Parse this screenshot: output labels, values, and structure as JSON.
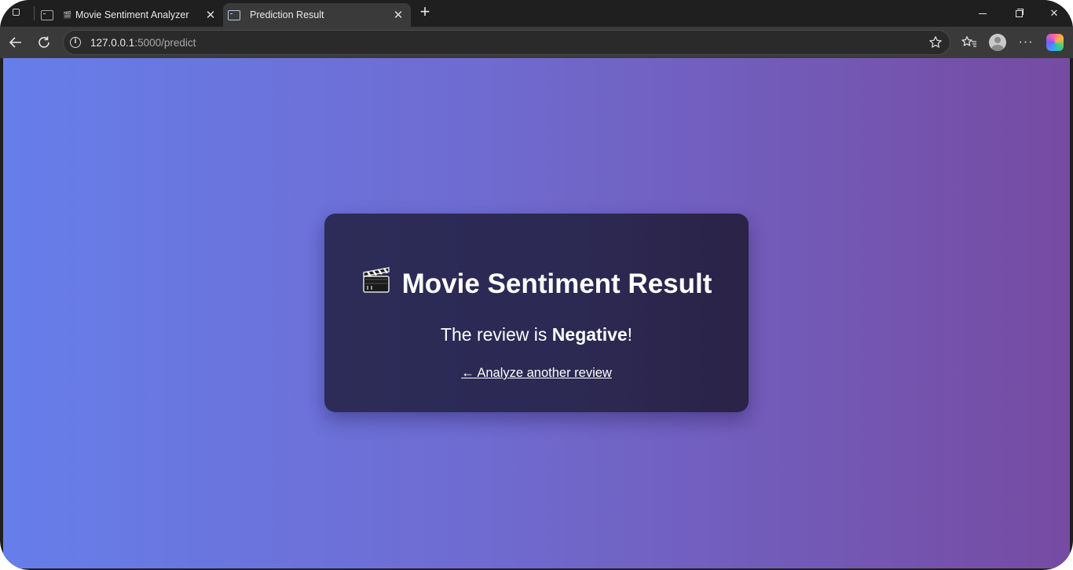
{
  "browser": {
    "tabs": [
      {
        "title": "Movie Sentiment Analyzer",
        "active": false,
        "icon": "terminal-favicon-icon"
      },
      {
        "title": "Prediction Result",
        "active": true,
        "icon": "terminal-favicon-icon"
      }
    ],
    "address_bar": {
      "host": "127.0.0.1",
      "path": ":5000/predict"
    }
  },
  "page": {
    "title": "Movie Sentiment Result",
    "title_icon": "clapperboard-icon",
    "result_prefix": "The review is ",
    "result_value": "Negative",
    "result_suffix": "!",
    "back_link": "← Analyze another review"
  },
  "colors": {
    "gradient_start": "#667eea",
    "gradient_end": "#764ba2",
    "card_bg": "#2d2c58",
    "text": "#ffffff"
  }
}
